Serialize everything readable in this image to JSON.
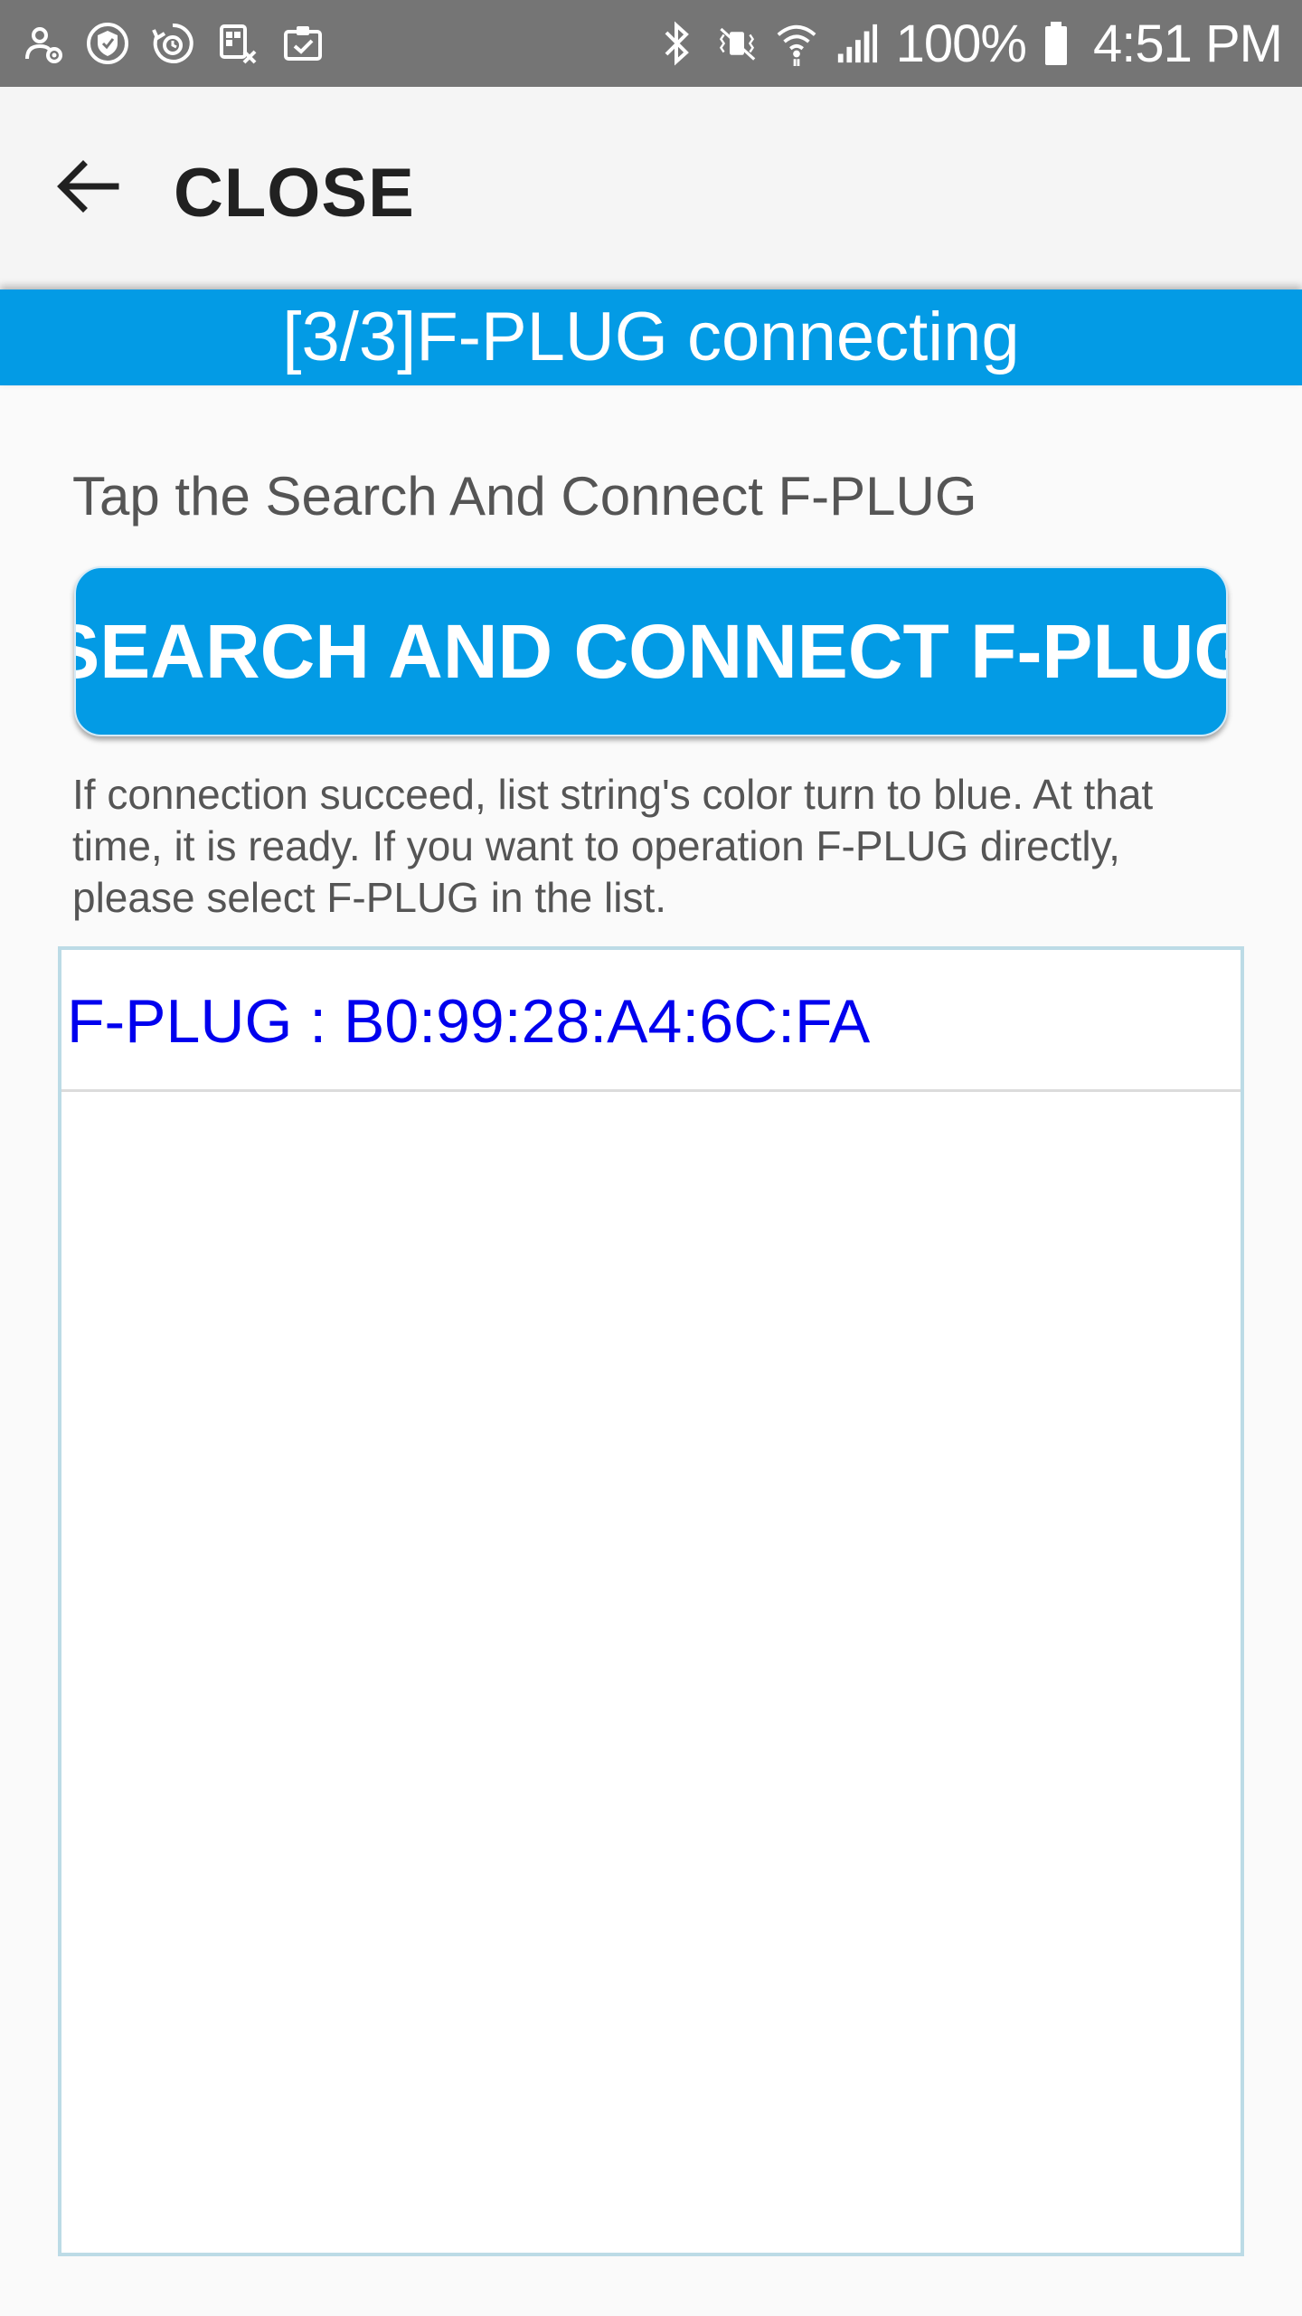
{
  "status_bar": {
    "left_icons": [
      "accessibility-settings-icon",
      "shield-icon",
      "refresh-timer-icon",
      "screen-cast-icon",
      "clipboard-check-icon"
    ],
    "right_icons": [
      "bluetooth-icon",
      "vibrate-mute-icon",
      "wifi-icon",
      "cellular-signal-icon",
      "battery-icon"
    ],
    "battery": "100%",
    "time": "4:51 PM"
  },
  "app_bar": {
    "back_icon": "arrow-back-icon",
    "close_label": "CLOSE"
  },
  "banner": {
    "title": "[3/3]F-PLUG connecting",
    "color": "#039be5"
  },
  "instruction": "Tap the Search And Connect F-PLUG",
  "search_button": {
    "label": "SEARCH AND CONNECT F-PLUG",
    "color": "#039be5"
  },
  "info_text": "If connection succeed, list string's color turn to blue. At that time, it is ready. If you want to operation F-PLUG directly, please select F-PLUG in the list.",
  "device_list": {
    "items": [
      {
        "label": "F-PLUG : B0:99:28:A4:6C:FA",
        "color": "#0000ee"
      }
    ]
  }
}
